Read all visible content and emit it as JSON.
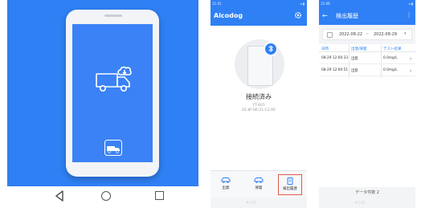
{
  "panel1": {
    "hero_icon": "truck-with-cloud-icon",
    "small_icon": "small-truck-app-icon",
    "nav": {
      "back": "back-triangle-icon",
      "home": "home-circle-icon",
      "recent": "recent-square-icon"
    },
    "colors": {
      "brand_blue": "#2f80f4"
    }
  },
  "panel2": {
    "status_left": "11:41",
    "status_right": "◂ ▮",
    "app_title": "Alcodog",
    "settings_icon": "gear-icon",
    "bluetooth_icon": "bluetooth-icon",
    "connection_status": "接続済み",
    "device_name": "YT-A01",
    "device_mac": "01:8F:66:21:C2:00",
    "tabs": [
      {
        "label": "出発",
        "icon": "car-depart-icon"
      },
      {
        "label": "帰着",
        "icon": "car-return-icon"
      },
      {
        "label": "検出履歴",
        "icon": "history-icon",
        "active": true
      }
    ],
    "sysnav": "◁ ○ □"
  },
  "panel3": {
    "status_left": "12:09",
    "status_right": "◂ ▮",
    "title": "検出履歴",
    "date_from": "2022-08-22",
    "date_sep": "~",
    "date_to": "2022-08-29",
    "columns": [
      "日時",
      "出発/帰着",
      "テスト結果"
    ],
    "rows": [
      {
        "datetime": "08-29 12:00:33",
        "type": "出発",
        "result": "0.0mg/L"
      },
      {
        "datetime": "08-29 12:00:51",
        "type": "出発",
        "result": "0.0mg/L"
      }
    ],
    "footer": "データ件数 2",
    "sysnav": "◁ ○ □"
  }
}
